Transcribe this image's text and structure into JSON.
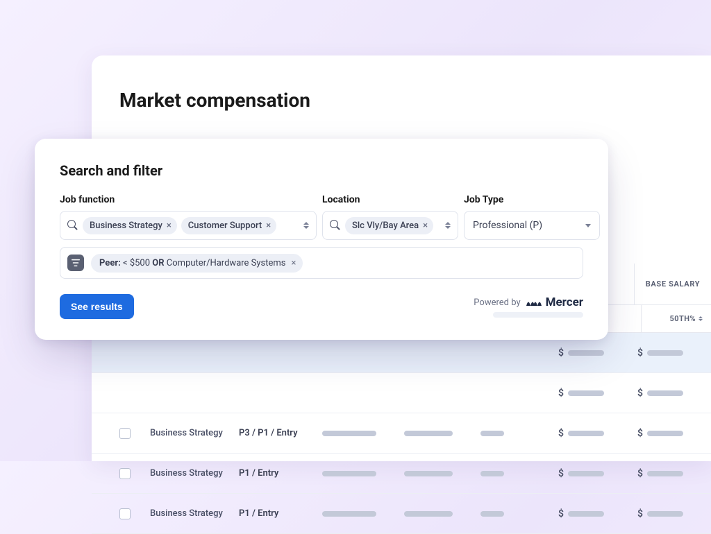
{
  "page": {
    "title": "Market compensation"
  },
  "filter": {
    "title": "Search and filter",
    "labels": {
      "job_function": "Job function",
      "location": "Location",
      "job_type": "Job Type"
    },
    "job_function_chips": [
      "Business Strategy",
      "Customer Support"
    ],
    "location_chips": [
      "Slc Vly/Bay Area"
    ],
    "job_type_selected": "Professional (P)",
    "peer_prefix": "Peer:",
    "peer_left": " < $500 ",
    "peer_or": "OR",
    "peer_right": " Computer/Hardware Systems",
    "see_results": "See results",
    "powered_by": "Powered by",
    "mercer": "Mercer"
  },
  "table": {
    "base_salary_label": "BASE SALARY",
    "pct_label": "50TH%",
    "rows": [
      {
        "strategy": "",
        "level": "",
        "highlight": true
      },
      {
        "strategy": "",
        "level": "",
        "highlight": false
      },
      {
        "strategy": "Business Strategy",
        "level": "P3 / P1 / Entry",
        "highlight": false
      },
      {
        "strategy": "Business Strategy",
        "level": "P1 / Entry",
        "highlight": false
      },
      {
        "strategy": "Business Strategy",
        "level": "P1 / Entry",
        "highlight": false
      }
    ]
  }
}
